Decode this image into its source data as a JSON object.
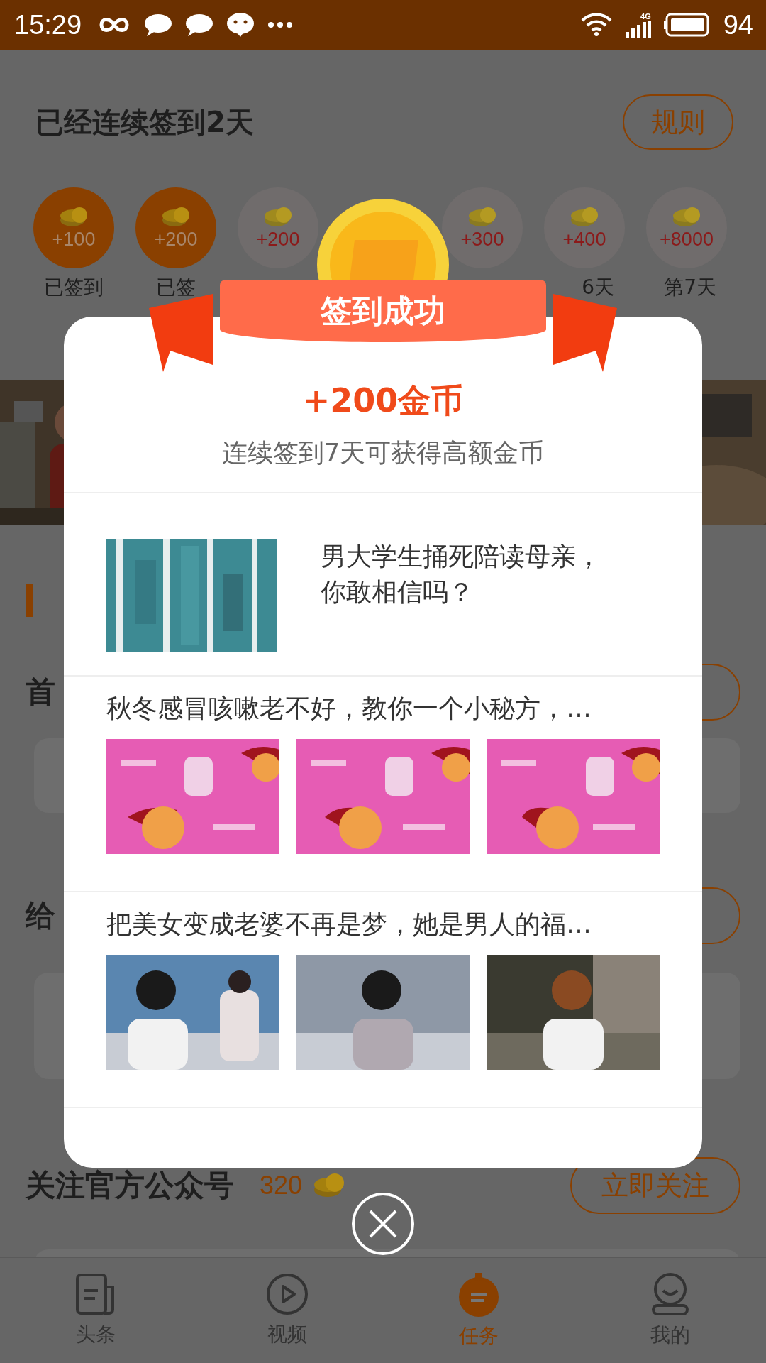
{
  "status_bar": {
    "time": "15:29",
    "network": "4G",
    "battery": "94"
  },
  "checkin": {
    "title": "已经连续签到2天",
    "rules_button": "规则",
    "days": [
      {
        "reward": "+100",
        "label": "已签到",
        "signed": true
      },
      {
        "reward": "+200",
        "label": "已签",
        "signed": true
      },
      {
        "reward": "+200",
        "signed": false
      },
      {
        "reward": "+300",
        "signed": false
      },
      {
        "reward": "+400",
        "label": "6天",
        "signed": false
      },
      {
        "reward": "+8000",
        "label": "第7天",
        "signed": false
      }
    ]
  },
  "tasks": [
    {
      "title": "首"
    },
    {
      "title": "给"
    },
    {
      "title": "关注官方公众号",
      "coins": "320",
      "button": "立即关注"
    }
  ],
  "bottom_nav": [
    {
      "label": "头条",
      "selected": false
    },
    {
      "label": "视频",
      "selected": false
    },
    {
      "label": "任务",
      "selected": true
    },
    {
      "label": "我的",
      "selected": false
    }
  ],
  "dialog": {
    "ribbon": "签到成功",
    "reward": "+200金币",
    "subtitle": "连续签到7天可获得高额金币",
    "news": [
      {
        "kind": "single",
        "title": "男大学生捅死陪读母亲，你敢相信吗？"
      },
      {
        "kind": "triple",
        "title": "秋冬感冒咳嗽老不好，教你一个小秘方，…"
      },
      {
        "kind": "triple",
        "title": "把美女变成老婆不再是梦，她是男人的福…"
      }
    ]
  }
}
